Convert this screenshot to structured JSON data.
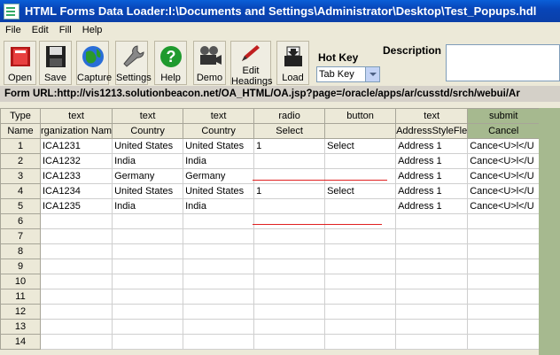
{
  "window": {
    "title": "HTML Forms Data Loader:I:\\Documents and Settings\\Administrator\\Desktop\\Test_Popups.hdl"
  },
  "menu": [
    "File",
    "Edit",
    "Fill",
    "Help"
  ],
  "toolbar": {
    "buttons": [
      {
        "label": "Open",
        "icon": "open-book-icon"
      },
      {
        "label": "Save",
        "icon": "floppy-disk-icon"
      },
      {
        "label": "Capture",
        "icon": "globe-icon"
      },
      {
        "label": "Settings",
        "icon": "wrench-icon"
      },
      {
        "label": "Help",
        "icon": "question-icon"
      },
      {
        "label": "Demo",
        "icon": "camera-icon"
      },
      {
        "label": "Edit",
        "label2": "Headings",
        "icon": "pen-icon"
      },
      {
        "label": "Load",
        "icon": "load-icon"
      }
    ],
    "hotkey_label": "Hot Key",
    "hotkey_value": "Tab Key",
    "description_label": "Description"
  },
  "url": "Form URL:http://vis1213.solutionbeacon.net/OA_HTML/OA.jsp?page=/oracle/apps/ar/cusstd/srch/webui/Ar",
  "grid": {
    "type_row": [
      "Type",
      "text",
      "text",
      "text",
      "radio",
      "button",
      "text",
      "submit"
    ],
    "name_row": [
      "Name",
      "rganization Nam",
      "Country",
      "Country",
      "Select",
      "",
      "AddressStyleFle",
      "Cancel"
    ],
    "rows": [
      [
        "1",
        "ICA1231",
        "United States",
        "United States",
        "1",
        "Select",
        "Address 1",
        "Cance<U>l</U"
      ],
      [
        "2",
        "ICA1232",
        "India",
        "India",
        "",
        "",
        "Address 1",
        "Cance<U>l</U"
      ],
      [
        "3",
        "ICA1233",
        "Germany",
        "Germany",
        "",
        "",
        "Address 1",
        "Cance<U>l</U"
      ],
      [
        "4",
        "ICA1234",
        "United States",
        "United States",
        "1",
        "Select",
        "Address 1",
        "Cance<U>l</U"
      ],
      [
        "5",
        "ICA1235",
        "India",
        "India",
        "",
        "",
        "Address 1",
        "Cance<U>l</U"
      ],
      [
        "6",
        "",
        "",
        "",
        "",
        "",
        "",
        ""
      ],
      [
        "7",
        "",
        "",
        "",
        "",
        "",
        "",
        ""
      ],
      [
        "8",
        "",
        "",
        "",
        "",
        "",
        "",
        ""
      ],
      [
        "9",
        "",
        "",
        "",
        "",
        "",
        "",
        ""
      ],
      [
        "10",
        "",
        "",
        "",
        "",
        "",
        "",
        ""
      ],
      [
        "11",
        "",
        "",
        "",
        "",
        "",
        "",
        ""
      ],
      [
        "12",
        "",
        "",
        "",
        "",
        "",
        "",
        ""
      ],
      [
        "13",
        "",
        "",
        "",
        "",
        "",
        "",
        ""
      ],
      [
        "14",
        "",
        "",
        "",
        "",
        "",
        "",
        ""
      ]
    ]
  },
  "colors": {
    "title_bar": "#0a4fc8",
    "submit_column": "#a6b98f",
    "annotation_line": "#e02020"
  }
}
